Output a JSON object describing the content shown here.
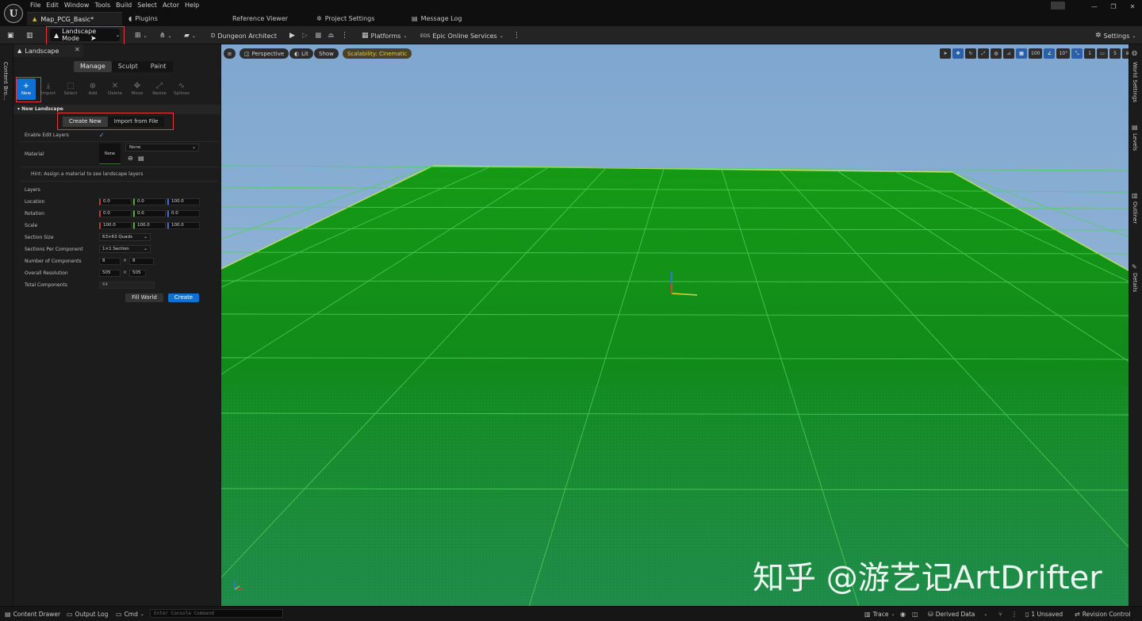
{
  "menu": [
    "File",
    "Edit",
    "Window",
    "Tools",
    "Build",
    "Select",
    "Actor",
    "Help"
  ],
  "logo": "U",
  "doc_tab": "Map_PCG_Basic*",
  "top_tabs": [
    {
      "label": "Plugins",
      "icon": "plug-icon"
    },
    {
      "label": "Reference Viewer",
      "icon": ""
    },
    {
      "label": "Project Settings",
      "icon": "gear-icon"
    },
    {
      "label": "Message Log",
      "icon": "log-icon"
    }
  ],
  "toolbar": {
    "mode": "Landscape Mode",
    "dungeon": "Dungeon Architect",
    "platforms": "Platforms",
    "eos": "Epic Online Services",
    "settings": "Settings"
  },
  "left_strip_label": "Content Bro...",
  "panel": {
    "tab": "Landscape",
    "modes": [
      "Manage",
      "Sculpt",
      "Paint"
    ],
    "active_mode": "Manage",
    "tools": [
      "New",
      "Import",
      "Select",
      "Add",
      "Delete",
      "Move",
      "Resize",
      "Splines"
    ],
    "section": "New Landscape",
    "create_tabs": [
      "Create New",
      "Import from File"
    ],
    "enable_edit_layers": "Enable Edit Layers",
    "material_label": "Material",
    "material_thumb": "None",
    "material_value": "None",
    "hint": "Hint: Assign a material to see landscape layers",
    "layers": "Layers",
    "location": {
      "label": "Location",
      "x": "0.0",
      "y": "0.0",
      "z": "100.0"
    },
    "rotation": {
      "label": "Rotation",
      "x": "0.0",
      "y": "0.0",
      "z": "0.0"
    },
    "scale": {
      "label": "Scale",
      "x": "100.0",
      "y": "100.0",
      "z": "100.0"
    },
    "section_size": {
      "label": "Section Size",
      "value": "63×63 Quads"
    },
    "sections_per_component": {
      "label": "Sections Per Component",
      "value": "1×1 Section"
    },
    "num_components": {
      "label": "Number of Components",
      "x": "8",
      "y": "8"
    },
    "overall_resolution": {
      "label": "Overall Resolution",
      "x": "505",
      "y": "505"
    },
    "total_components": {
      "label": "Total Components",
      "value": "64"
    },
    "fill_world": "Fill World",
    "create": "Create"
  },
  "viewport": {
    "perspective": "Perspective",
    "lit": "Lit",
    "show": "Show",
    "scalability": "Scalability: Cinematic",
    "grid_snap": "100",
    "rot_snap": "10°",
    "scale_snap": "1",
    "cam_speed": "5",
    "watermark": "知乎 @游艺记ArtDrifter"
  },
  "right_strip": [
    "World Settings",
    "Levels",
    "Outliner",
    "Details"
  ],
  "statusbar": {
    "content_drawer": "Content Drawer",
    "output_log": "Output Log",
    "cmd": "Cmd",
    "console_placeholder": "Enter Console Command",
    "trace": "Trace",
    "derived_data": "Derived Data",
    "unsaved": "1 Unsaved",
    "revision": "Revision Control"
  }
}
